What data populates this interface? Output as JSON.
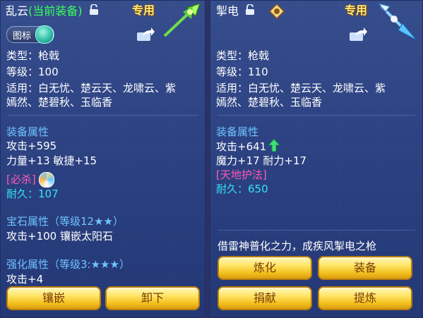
{
  "left": {
    "name": "乱云",
    "current_tag": "(当前装备)",
    "badge": "专用",
    "toggle_label": "图标",
    "type_line": "类型：枪戟",
    "level_line": "等级：100",
    "suit_line1": "适用：白无忧、楚云天、龙啸云、紫",
    "suit_line2": "嫣然、楚碧秋、玉临香",
    "attr_header": "装备属性",
    "attack": "攻击+595",
    "stats": "力量+13 敏捷+15",
    "special": "[必杀]",
    "durability": "耐久：107",
    "gem_header": "宝石属性（等级12★★）",
    "gem_line": "攻击+100 镶嵌太阳石",
    "enhance_header": "强化属性（等级3:★★★）",
    "enhance_line": "攻击+4",
    "buttons": [
      "镶嵌",
      "卸下"
    ]
  },
  "right": {
    "name": "掣电",
    "badge": "专用",
    "type_line": "类型：枪戟",
    "level_line": "等级：110",
    "suit_line1": "适用：白无忧、楚云天、龙啸云、紫",
    "suit_line2": "嫣然、楚碧秋、玉临香",
    "attr_header": "装备属性",
    "attack": "攻击+641",
    "stats": "魔力+17 耐力+17",
    "special": "[天地护法]",
    "durability": "耐久：650",
    "description": "借雷神普化之力，成疾风掣电之枪",
    "buttons": [
      "炼化",
      "装备",
      "捐献",
      "提炼"
    ]
  },
  "icons": [
    "lock-icon",
    "evaluate-icon",
    "share-icon",
    "weapon-icon",
    "up-arrow-icon",
    "special-skill-icon"
  ],
  "colors": {
    "label": "#6fc3ff",
    "special": "#ff5ab4",
    "durability": "#33e3f2",
    "current_tag": "#38ff5a",
    "button_gold": "#ffe566"
  }
}
